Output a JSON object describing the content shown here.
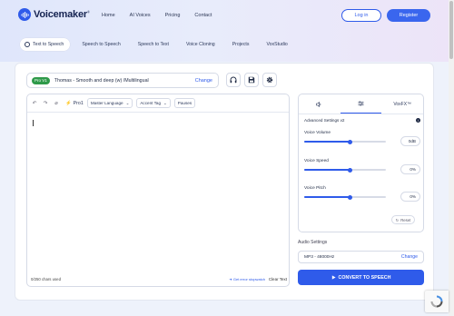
{
  "brand": {
    "name": "Voicemaker",
    "mark": "®"
  },
  "nav": [
    "Home",
    "AI Voices",
    "Pricing",
    "Contact"
  ],
  "auth": {
    "login": "Log in",
    "register": "Register"
  },
  "tabs": [
    {
      "label": "Text to Speech",
      "active": true
    },
    {
      "label": "Speech to Speech",
      "active": false
    },
    {
      "label": "Speech to Text",
      "active": false
    },
    {
      "label": "Voice Cloning",
      "active": false
    },
    {
      "label": "Projects",
      "active": false
    },
    {
      "label": "VoxStudio",
      "active": false
    }
  ],
  "voice": {
    "badge": "Pro V1",
    "name": "Thomas - Smooth and deep (w) /Multilingual",
    "change": "Change"
  },
  "editor": {
    "pro_label": "Pro1",
    "language_dropdown": "Master Language",
    "accent_dropdown": "Accent Tag",
    "pauses_button": "Pauses",
    "char_count": "0/250 chars used",
    "error_link": "Get error stopwatch",
    "clear_text": "Clear Text"
  },
  "panel": {
    "tabs": [
      {
        "icon": "speaker-icon",
        "label": ""
      },
      {
        "icon": "sliders-icon",
        "label": ""
      },
      {
        "icon": "",
        "label": "VoxFX™"
      }
    ],
    "advanced_label": "Advanced Settings v2",
    "settings": [
      {
        "label": "Voice Volume",
        "value": "0dB",
        "level": 0.56
      },
      {
        "label": "Voice Speed",
        "value": "0%",
        "level": 0.56
      },
      {
        "label": "Voice Pitch",
        "value": "0%",
        "level": 0.56
      }
    ],
    "reset": "Reset"
  },
  "audio": {
    "label": "Audio Settings",
    "value": "MP3 - 48000Hz",
    "change": "Change"
  },
  "convert_button": "CONVERT TO SPEECH",
  "colors": {
    "accent": "#2f5bea",
    "pro_badge": "#2f9a4a"
  }
}
